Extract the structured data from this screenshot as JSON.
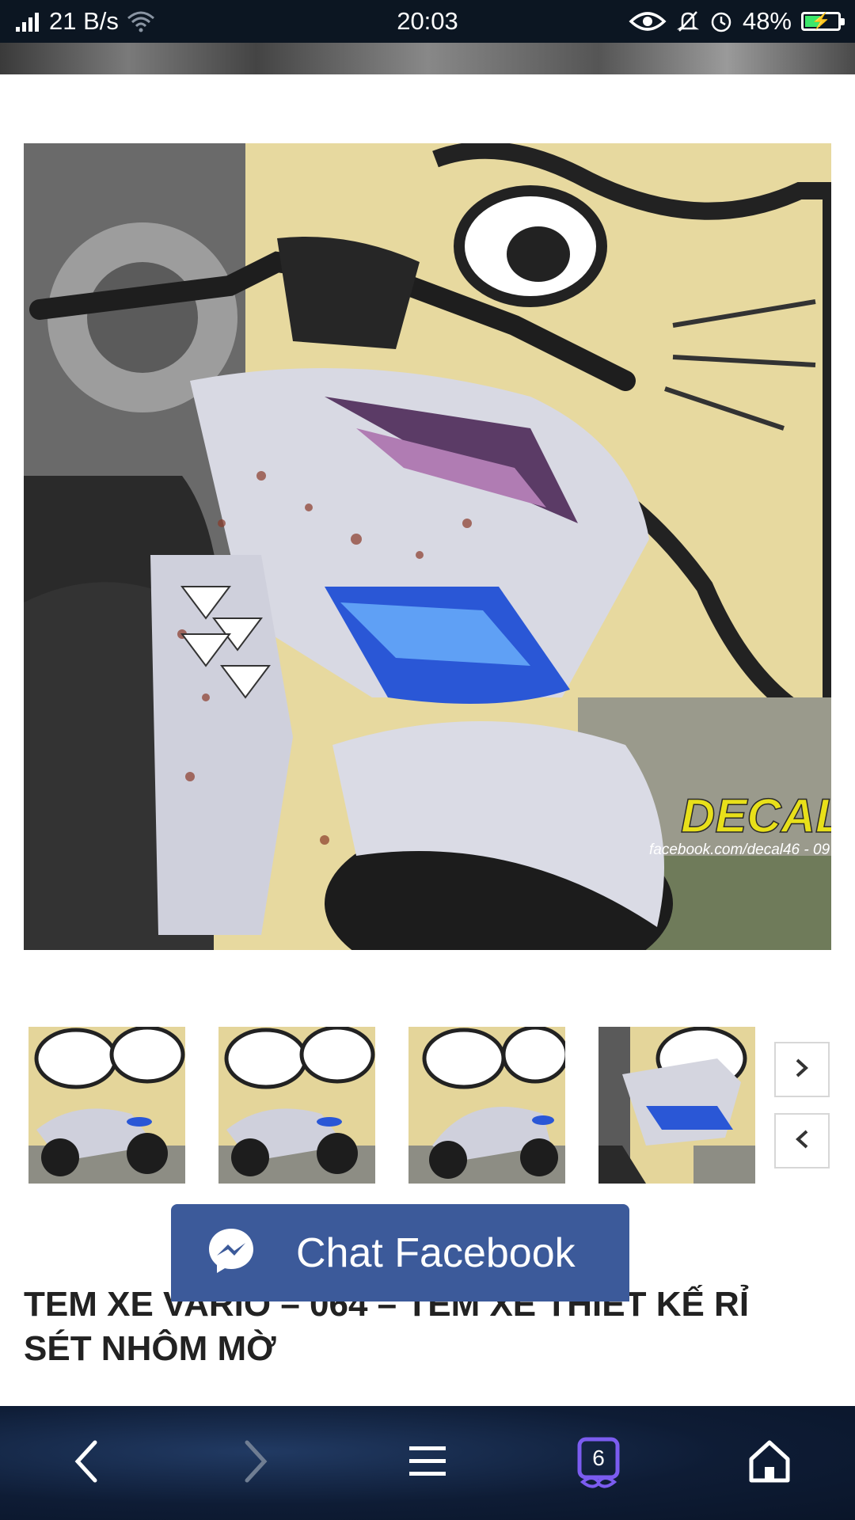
{
  "status_bar": {
    "network_speed": "21 B/s",
    "time": "20:03",
    "battery_percent": "48%",
    "battery_level": 0.48,
    "icons": [
      "signal-icon",
      "wifi-icon",
      "eye-icon",
      "bell-off-icon",
      "alarm-icon",
      "battery-icon"
    ]
  },
  "gallery": {
    "watermark_brand": "DECAL",
    "watermark_url": "facebook.com/decal46 - 09",
    "thumbnails": [
      {
        "name": "thumbnail-1"
      },
      {
        "name": "thumbnail-2"
      },
      {
        "name": "thumbnail-3"
      },
      {
        "name": "thumbnail-4"
      }
    ],
    "next_icon": "chevron-right-icon",
    "prev_icon": "chevron-left-icon"
  },
  "chat": {
    "label": "Chat Facebook",
    "icon": "messenger-icon",
    "color": "#3c5a9a"
  },
  "product": {
    "title": "TEM XE VARIO – 064 – TEM XE THIẾT KẾ RỈ SÉT NHÔM MỜ"
  },
  "browser_bar": {
    "tab_count": "6",
    "icons": [
      "back-icon",
      "forward-icon",
      "menu-icon",
      "tabs-icon",
      "home-icon"
    ]
  }
}
